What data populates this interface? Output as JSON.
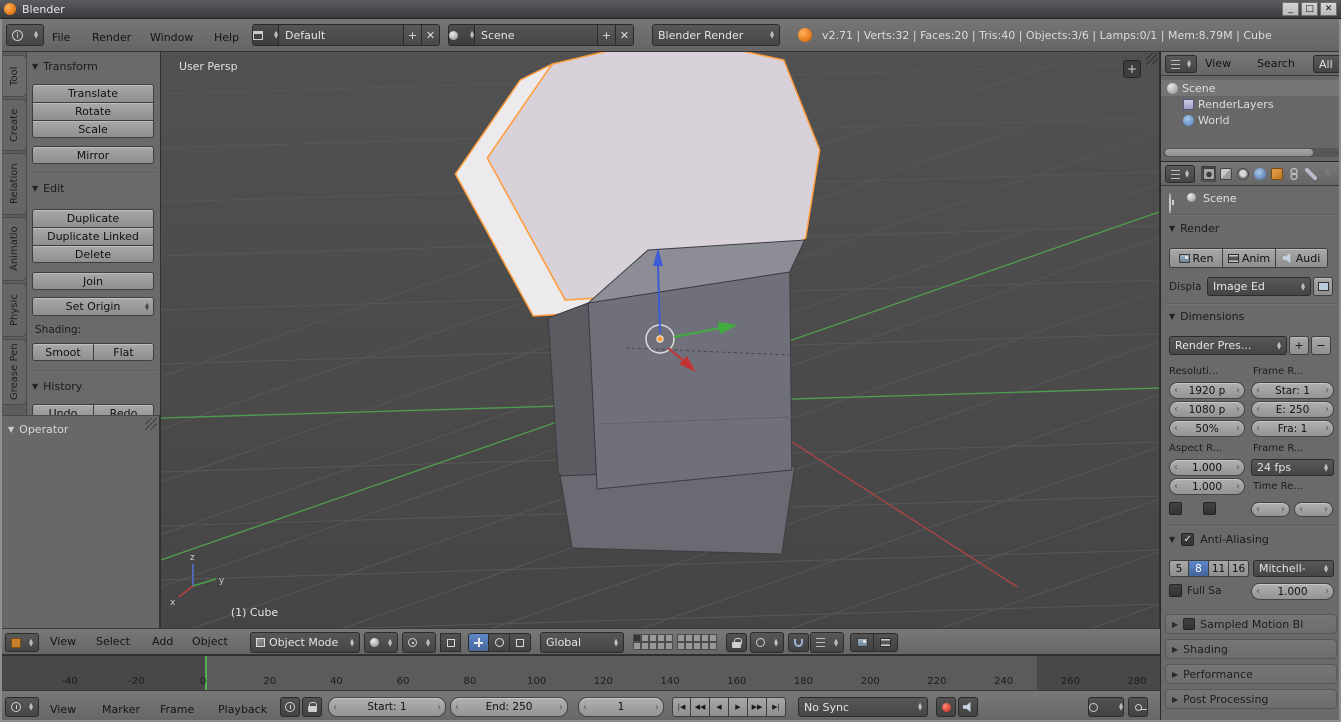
{
  "window": {
    "title": "Blender",
    "minimize": "_",
    "maximize": "□",
    "close": "✕"
  },
  "icons": {
    "collapse": "▼",
    "expand": "▶",
    "add": "+",
    "minus": "−",
    "close": "✕",
    "transport": [
      "|◀",
      "◀◀",
      "◀",
      "▶",
      "▶▶",
      "▶|"
    ]
  },
  "infobar": {
    "menus": [
      "File",
      "Render",
      "Window",
      "Help"
    ],
    "layout": "Default",
    "scene": "Scene",
    "engine": "Blender Render",
    "stats": "v2.71 | Verts:32 | Faces:20 | Tris:40 | Objects:3/6 | Lamps:0/1 | Mem:8.79M | Cube"
  },
  "toolshelf": {
    "tabs": [
      "Tool",
      "Create",
      "Relation",
      "Animatio",
      "Physic",
      "Grease Pen"
    ],
    "transform": {
      "title": "Transform",
      "translate": "Translate",
      "rotate": "Rotate",
      "scale": "Scale",
      "mirror": "Mirror"
    },
    "edit": {
      "title": "Edit",
      "duplicate": "Duplicate",
      "duplicate_linked": "Duplicate Linked",
      "delete": "Delete",
      "join": "Join",
      "set_origin": "Set Origin",
      "shading_label": "Shading:",
      "smooth": "Smoot",
      "flat": "Flat"
    },
    "history": {
      "title": "History",
      "undo": "Undo",
      "redo": "Redo"
    },
    "operator_title": "Operator"
  },
  "viewport": {
    "view_label": "User Persp",
    "object_label": "(1) Cube",
    "axis": {
      "x": "x",
      "y": "y",
      "z": "z"
    },
    "header": {
      "menus": [
        "View",
        "Select",
        "Add",
        "Object"
      ],
      "mode": "Object Mode",
      "orientation": "Global"
    }
  },
  "outliner": {
    "menus": [
      "View",
      "Search"
    ],
    "filter": "All",
    "items": [
      "Scene",
      "RenderLayers",
      "World"
    ]
  },
  "properties": {
    "context": "Scene",
    "render": {
      "title": "Render",
      "render_btn": "Ren",
      "anim_btn": "Anim",
      "audio_btn": "Audi",
      "display_label": "Displa",
      "display_value": "Image Ed"
    },
    "dimensions": {
      "title": "Dimensions",
      "preset": "Render Pres...",
      "resolution_label": "Resoluti...",
      "frame_range_label": "Frame R...",
      "res_x": "1920 p",
      "res_y": "1080 p",
      "res_pct": "50%",
      "frame_start": "Star: 1",
      "frame_end": "E: 250",
      "frame_step": "Fra: 1",
      "aspect_label": "Aspect R...",
      "frame_rate_label": "Frame R...",
      "aspect_x": "1.000",
      "aspect_y": "1.000",
      "fps": "24 fps",
      "time_remap_label": "Time Re..."
    },
    "antialiasing": {
      "title": "Anti-Aliasing",
      "samples": [
        "5",
        "8",
        "11",
        "16"
      ],
      "filter": "Mitchell-",
      "full_sample": "Full Sa",
      "filter_size": "1.000"
    },
    "collapsed_panels": [
      {
        "label": "Sampled Motion Bl",
        "checkbox": true
      },
      {
        "label": "Shading"
      },
      {
        "label": "Performance"
      },
      {
        "label": "Post Processing"
      }
    ]
  },
  "timeline": {
    "menus": [
      "View",
      "Marker",
      "Frame",
      "Playback"
    ],
    "start": "Start: 1",
    "end": "End: 250",
    "frame": "1",
    "sync": "No Sync",
    "ruler": {
      "ticks": [
        -40,
        -20,
        0,
        20,
        40,
        60,
        80,
        100,
        120,
        140,
        160,
        180,
        200,
        220,
        240,
        260,
        280
      ],
      "frame_start": 1,
      "frame_end": 250,
      "current": 1
    }
  }
}
